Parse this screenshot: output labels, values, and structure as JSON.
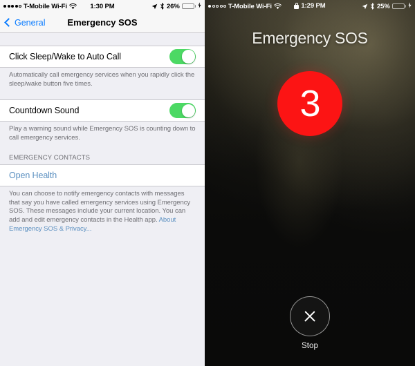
{
  "left_panel": {
    "status_bar": {
      "signal_dots_filled": 4,
      "signal_dots_total": 5,
      "carrier": "T-Mobile Wi-Fi",
      "wifi_icon": "wifi-icon",
      "time": "1:30 PM",
      "location_icon": "location-arrow-icon",
      "bluetooth_icon": "bluetooth-icon",
      "battery_percent": "26%",
      "battery_level": 26,
      "battery_charging": true
    },
    "nav_bar": {
      "back_label": "General",
      "back_icon": "chevron-left-icon",
      "title": "Emergency SOS"
    },
    "rows": [
      {
        "label": "Click Sleep/Wake to Auto Call",
        "toggle_on": true,
        "footnote": "Automatically call emergency services when you rapidly click the sleep/wake button five times."
      },
      {
        "label": "Countdown Sound",
        "toggle_on": true,
        "footnote": "Play a warning sound while Emergency SOS is counting down to call emergency services."
      }
    ],
    "section_header": "EMERGENCY CONTACTS",
    "open_health_label": "Open Health",
    "contacts_footnote": {
      "text": "You can choose to notify emergency contacts with messages that say you have called emergency services using Emergency SOS. These messages include your current location. You can add and edit emergency contacts in the Health app. ",
      "link": "About Emergency SOS & Privacy..."
    }
  },
  "right_panel": {
    "status_bar": {
      "signal_dots_filled": 1,
      "signal_dots_total": 5,
      "carrier": "T-Mobile Wi-Fi",
      "wifi_icon": "wifi-icon",
      "lock_icon": "lock-icon",
      "time": "1:29 PM",
      "location_icon": "location-arrow-icon",
      "bluetooth_icon": "bluetooth-icon",
      "battery_percent": "25%",
      "battery_level": 25,
      "battery_charging": true
    },
    "title": "Emergency SOS",
    "countdown_value": "3",
    "stop_button": {
      "label": "Stop",
      "icon": "close-x-icon"
    }
  },
  "colors": {
    "ios_blue": "#0a7cff",
    "link_blue": "#5a8fc0",
    "toggle_green": "#4cd964",
    "countdown_red": "#fc1414",
    "settings_bg": "#efeff4",
    "battery_yellow": "#f8cf26"
  }
}
